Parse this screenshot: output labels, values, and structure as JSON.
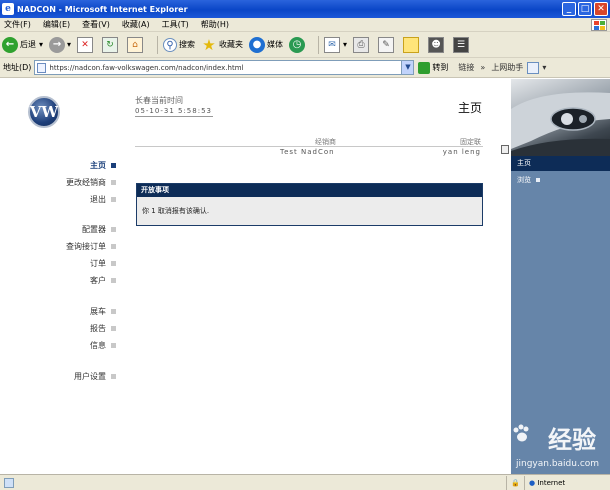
{
  "window": {
    "title": "NADCON - Microsoft Internet Explorer",
    "btn_minimize": "_",
    "btn_maximize": "□",
    "btn_close": "✕"
  },
  "menu": [
    "文件(F)",
    "编辑(E)",
    "查看(V)",
    "收藏(A)",
    "工具(T)",
    "帮助(H)"
  ],
  "toolbar": {
    "back": "后退",
    "search": "搜索",
    "favorites": "收藏夹",
    "media": "媒体"
  },
  "address": {
    "label": "地址(D)",
    "url": "https://nadcon.faw-volkswagen.com/nadcon/index.html",
    "go": "转到",
    "links": "链接",
    "online_banking": "上网助手"
  },
  "logo": "VW",
  "sidebar": {
    "items": [
      "主页",
      "更改经销商",
      "退出",
      "配置器",
      "查询接订单",
      "订单",
      "客户",
      "展车",
      "报告",
      "信息",
      "用户设置"
    ]
  },
  "header": {
    "datetime_label": "长春当前时间",
    "datetime_value": "05-10-31 5:58:53",
    "page_title": "主页",
    "dealer_label": "经销商",
    "dealer_value": "Test NadCon",
    "contact_label": "固定联",
    "contact_value": "yan leng"
  },
  "panel": {
    "title": "开放事项",
    "body": "你 1 取消报有该确认."
  },
  "rightnav": {
    "items": [
      "主页",
      "浏览"
    ]
  },
  "status": {
    "zone": "Internet"
  },
  "watermark": {
    "brand": "Bai",
    "brand_cn": "经验",
    "sub": "jingyan.baidu.com"
  },
  "colors": {
    "navy": "#0d2c57",
    "steel_blue": "#6685a9",
    "xp_blue": "#0a46c7"
  }
}
